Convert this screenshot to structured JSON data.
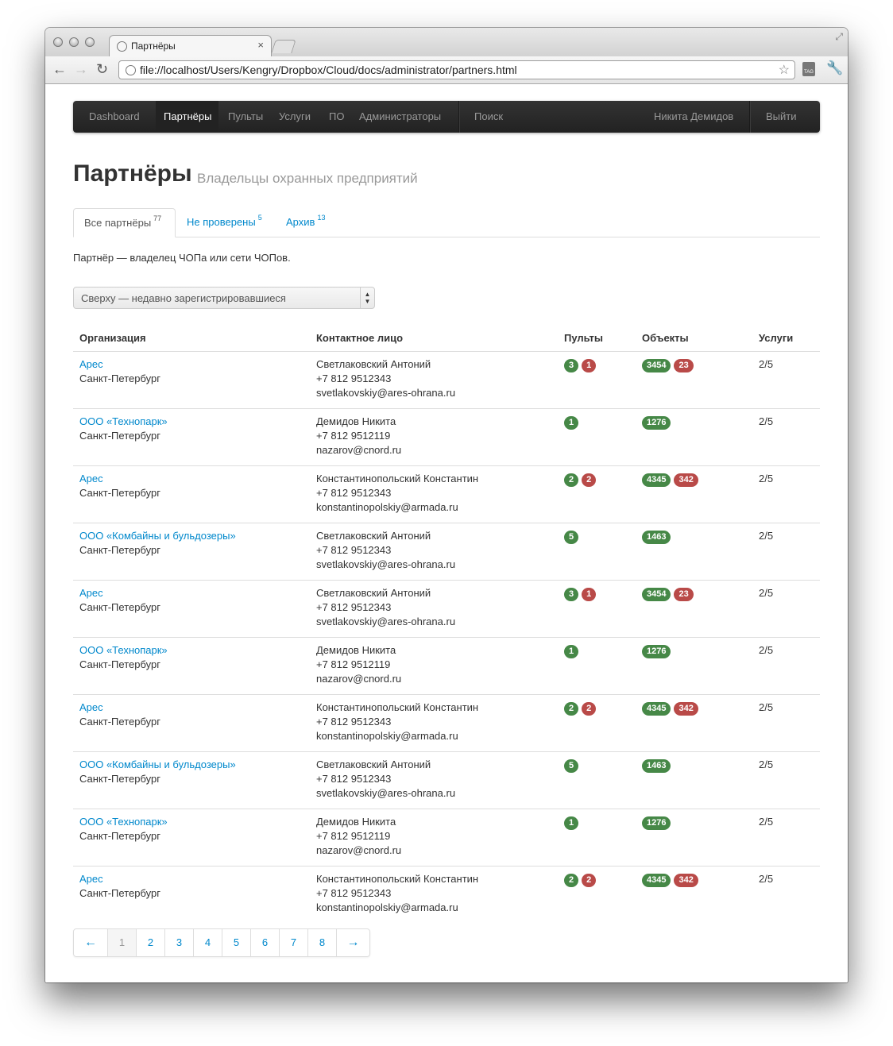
{
  "browser": {
    "tab_title": "Партнёры",
    "url": "file://localhost/Users/Kengry/Dropbox/Cloud/docs/administrator/partners.html",
    "tag_icon_text": "TAG"
  },
  "navbar": {
    "items": [
      "Dashboard",
      "Партнёры",
      "Пульты",
      "Услуги",
      "ПО",
      "Администраторы"
    ],
    "active_item": "Партнёры",
    "search": "Поиск",
    "user": "Никита Демидов",
    "logout": "Выйти"
  },
  "page": {
    "title": "Партнёры",
    "subtitle": "Владельцы охранных предприятий",
    "description": "Партнёр — владелец ЧОПа или сети ЧОПов."
  },
  "tabs": [
    {
      "label": "Все партнёры",
      "count": "77"
    },
    {
      "label": "Не проверены",
      "count": "5"
    },
    {
      "label": "Архив",
      "count": "13"
    }
  ],
  "sort_select": {
    "value": "Сверху — недавно зарегистрировавшиеся"
  },
  "table": {
    "headers": [
      "Организация",
      "Контактное лицо",
      "Пульты",
      "Объекты",
      "Услуги"
    ],
    "rows": [
      {
        "org": "Арес",
        "city": "Санкт-Петербург",
        "contact": "Светлаковский Антоний",
        "phone": "+7 812 9512343",
        "email": "svetlakovskiy@ares-ohrana.ru",
        "consoles_ok": "3",
        "consoles_bad": "1",
        "objects_ok": "3454",
        "objects_bad": "23",
        "services": "2/5"
      },
      {
        "org": "ООО «Технопарк»",
        "city": "Санкт-Петербург",
        "contact": "Демидов Никита",
        "phone": "+7 812 9512119",
        "email": "nazarov@cnord.ru",
        "consoles_ok": "1",
        "consoles_bad": "",
        "objects_ok": "1276",
        "objects_bad": "",
        "services": "2/5"
      },
      {
        "org": "Арес",
        "city": "Санкт-Петербург",
        "contact": "Константинопольский Константин",
        "phone": "+7 812 9512343",
        "email": "konstantinopolskiy@armada.ru",
        "consoles_ok": "2",
        "consoles_bad": "2",
        "objects_ok": "4345",
        "objects_bad": "342",
        "services": "2/5"
      },
      {
        "org": "ООО «Комбайны и бульдозеры»",
        "city": "Санкт-Петербург",
        "contact": "Светлаковский Антоний",
        "phone": "+7 812 9512343",
        "email": "svetlakovskiy@ares-ohrana.ru",
        "consoles_ok": "5",
        "consoles_bad": "",
        "objects_ok": "1463",
        "objects_bad": "",
        "services": "2/5"
      },
      {
        "org": "Арес",
        "city": "Санкт-Петербург",
        "contact": "Светлаковский Антоний",
        "phone": "+7 812 9512343",
        "email": "svetlakovskiy@ares-ohrana.ru",
        "consoles_ok": "3",
        "consoles_bad": "1",
        "objects_ok": "3454",
        "objects_bad": "23",
        "services": "2/5"
      },
      {
        "org": "ООО «Технопарк»",
        "city": "Санкт-Петербург",
        "contact": "Демидов Никита",
        "phone": "+7 812 9512119",
        "email": "nazarov@cnord.ru",
        "consoles_ok": "1",
        "consoles_bad": "",
        "objects_ok": "1276",
        "objects_bad": "",
        "services": "2/5"
      },
      {
        "org": "Арес",
        "city": "Санкт-Петербург",
        "contact": "Константинопольский Константин",
        "phone": "+7 812 9512343",
        "email": "konstantinopolskiy@armada.ru",
        "consoles_ok": "2",
        "consoles_bad": "2",
        "objects_ok": "4345",
        "objects_bad": "342",
        "services": "2/5"
      },
      {
        "org": "ООО «Комбайны и бульдозеры»",
        "city": "Санкт-Петербург",
        "contact": "Светлаковский Антоний",
        "phone": "+7 812 9512343",
        "email": "svetlakovskiy@ares-ohrana.ru",
        "consoles_ok": "5",
        "consoles_bad": "",
        "objects_ok": "1463",
        "objects_bad": "",
        "services": "2/5"
      },
      {
        "org": "ООО «Технопарк»",
        "city": "Санкт-Петербург",
        "contact": "Демидов Никита",
        "phone": "+7 812 9512119",
        "email": "nazarov@cnord.ru",
        "consoles_ok": "1",
        "consoles_bad": "",
        "objects_ok": "1276",
        "objects_bad": "",
        "services": "2/5"
      },
      {
        "org": "Арес",
        "city": "Санкт-Петербург",
        "contact": "Константинопольский Константин",
        "phone": "+7 812 9512343",
        "email": "konstantinopolskiy@armada.ru",
        "consoles_ok": "2",
        "consoles_bad": "2",
        "objects_ok": "4345",
        "objects_bad": "342",
        "services": "2/5"
      }
    ]
  },
  "pagination": {
    "prev": "←",
    "pages": [
      "1",
      "2",
      "3",
      "4",
      "5",
      "6",
      "7",
      "8"
    ],
    "current": "1",
    "next": "→"
  },
  "colors": {
    "link": "#0088cc",
    "badge_success": "#468847",
    "badge_important": "#b94a48",
    "navbar": "#222222"
  }
}
